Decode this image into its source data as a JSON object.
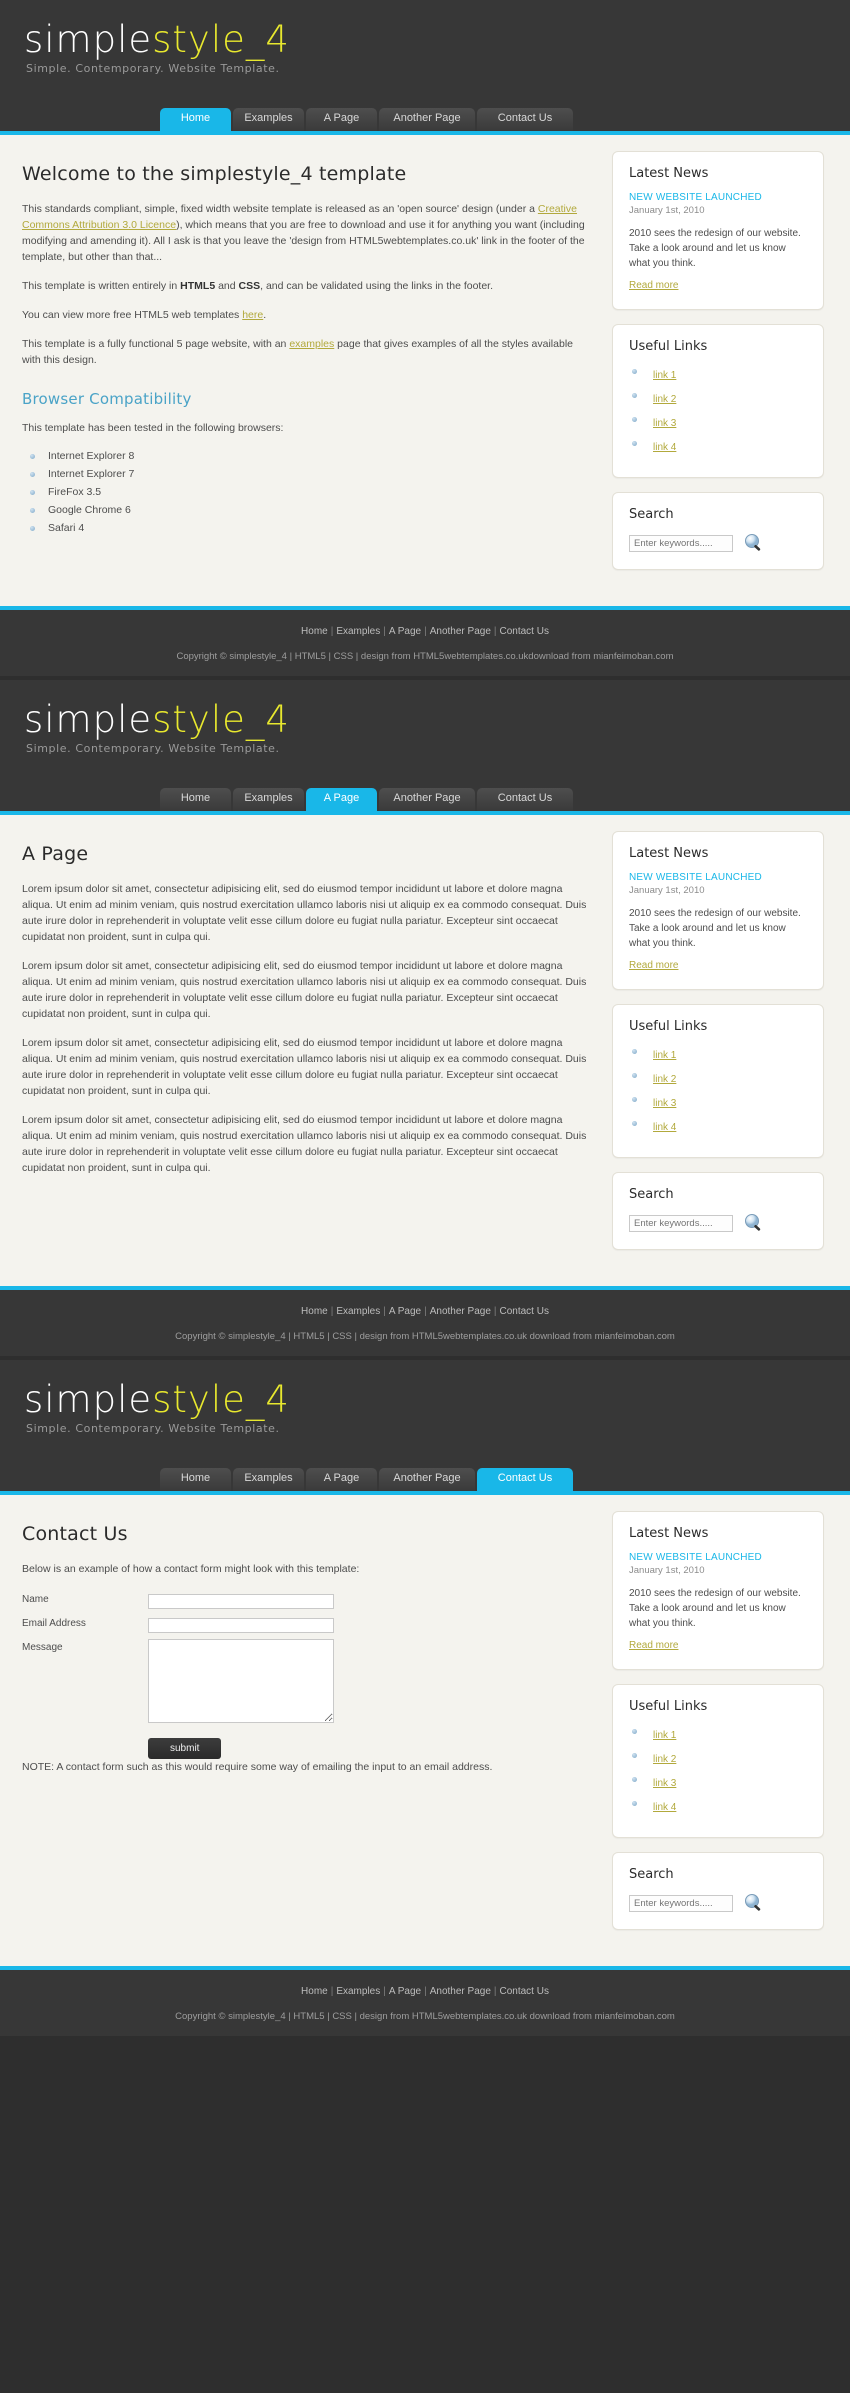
{
  "brand": {
    "part1": "simple",
    "part2": "style_4",
    "tagline": "Simple. Contemporary. Website Template.",
    "accent": "#19b7e8",
    "yellow": "#e8e82e",
    "link_gold": "#b2a93c"
  },
  "nav": [
    {
      "label": "Home"
    },
    {
      "label": "Examples"
    },
    {
      "label": "A Page"
    },
    {
      "label": "Another Page"
    },
    {
      "label": "Contact Us"
    }
  ],
  "home": {
    "title": "Welcome to the simplestyle_4 template",
    "p1_before": "This standards compliant, simple, fixed width website template is released as an 'open source' design (under a ",
    "p1_link": "Creative Commons Attribution 3.0 Licence",
    "p1_after": "), which means that you are free to download and use it for anything you want (including modifying and amending it). All I ask is that you leave the 'design from HTML5webtemplates.co.uk' link in the footer of the template, but other than that...",
    "p2_a": "This template is written entirely in ",
    "p2_b": "HTML5",
    "p2_c": " and ",
    "p2_d": "CSS",
    "p2_e": ", and can be validated using the links in the footer.",
    "p3_before": "You can view more free HTML5 web templates ",
    "p3_link": "here",
    "p3_after": ".",
    "p4_before": "This template is a fully functional 5 page website, with an ",
    "p4_link": "examples",
    "p4_after": " page that gives examples of all the styles available with this design.",
    "subtitle": "Browser Compatibility",
    "p5": "This template has been tested in the following browsers:",
    "browsers": [
      "Internet Explorer 8",
      "Internet Explorer 7",
      "FireFox 3.5",
      "Google Chrome 6",
      "Safari 4"
    ]
  },
  "apage": {
    "title": "A Page",
    "paragraph": "Lorem ipsum dolor sit amet, consectetur adipisicing elit, sed do eiusmod tempor incididunt ut labore et dolore magna aliqua. Ut enim ad minim veniam, quis nostrud exercitation ullamco laboris nisi ut aliquip ex ea commodo consequat. Duis aute irure dolor in reprehenderit in voluptate velit esse cillum dolore eu fugiat nulla pariatur. Excepteur sint occaecat cupidatat non proident, sunt in culpa qui."
  },
  "contact": {
    "title": "Contact Us",
    "intro": "Below is an example of how a contact form might look with this template:",
    "fields": [
      {
        "label": "Name",
        "value": "",
        "type": "text"
      },
      {
        "label": "Email Address",
        "value": "",
        "type": "text"
      },
      {
        "label": "Message",
        "value": "",
        "type": "textarea"
      }
    ],
    "submit_label": "submit",
    "note": "NOTE: A contact form such as this would require some way of emailing the input to an email address."
  },
  "sidebar": {
    "news": {
      "heading": "Latest News",
      "headline": "NEW WEBSITE LAUNCHED",
      "date": "January 1st, 2010",
      "body": "2010 sees the redesign of our website. Take a look around and let us know what you think.",
      "readmore": "Read more"
    },
    "links": {
      "heading": "Useful Links",
      "items": [
        "link 1",
        "link 2",
        "link 3",
        "link 4"
      ]
    },
    "search": {
      "heading": "Search",
      "placeholder": "Enter keywords.....",
      "value": "",
      "icon": "magnifier-icon"
    }
  },
  "footer": {
    "nav": [
      "Home",
      "Examples",
      "A Page",
      "Another Page",
      "Contact Us"
    ],
    "copy_1": "Copyright © simplestyle_4",
    "copy_html5": "HTML5",
    "copy_css": "CSS",
    "copy_design": "design from HTML5webtemplates.co.ukdownload from mianfeimoban.com",
    "copy_design_2": "design from HTML5webtemplates.co.uk download from mianfeimoban.com",
    "separator": "|"
  }
}
